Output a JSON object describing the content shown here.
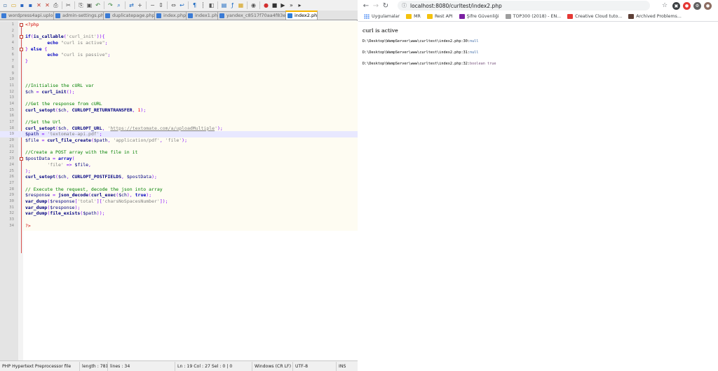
{
  "editor": {
    "toolbar_icons": [
      "new-file-icon",
      "open-file-icon",
      "save-icon",
      "save-all-icon",
      "close-icon",
      "close-all-icon",
      "print-icon",
      "cut-icon",
      "copy-icon",
      "paste-icon",
      "undo-icon",
      "redo-icon",
      "find-icon",
      "replace-icon",
      "zoom-in-icon",
      "zoom-out-icon",
      "sync-v-icon",
      "sync-h-icon",
      "word-wrap-icon",
      "all-chars-icon",
      "indent-guide-icon",
      "udl-icon",
      "doc-map-icon",
      "function-list-icon",
      "folder-workspace-icon",
      "monitor-icon",
      "record-icon",
      "stop-icon",
      "play-icon",
      "play-multi-icon",
      "save-macro-icon"
    ],
    "tabs": [
      {
        "label": "wordpress4api.uploader",
        "active": false
      },
      {
        "label": "admin-settings.php",
        "active": false
      },
      {
        "label": "duplicatepage.php",
        "active": false
      },
      {
        "label": "index.php",
        "active": false
      },
      {
        "label": "index1.php",
        "active": false
      },
      {
        "label": "yandex_c8517f70aa4f83e9b.html",
        "active": false
      },
      {
        "label": "index2.php",
        "active": true
      }
    ],
    "lines": [
      {
        "n": "1",
        "tokens": [
          [
            "php",
            "<?php"
          ]
        ]
      },
      {
        "n": "2",
        "tokens": []
      },
      {
        "n": "3",
        "tokens": [
          [
            "kw",
            "if"
          ],
          [
            "op",
            "("
          ],
          [
            "fn",
            "is_callable"
          ],
          [
            "op",
            "("
          ],
          [
            "str",
            "'curl_init'"
          ],
          [
            "op",
            "))"
          ],
          [
            "op",
            "{"
          ]
        ]
      },
      {
        "n": "4",
        "tokens": [
          [
            "",
            "        "
          ],
          [
            "kw",
            "echo"
          ],
          [
            "",
            " "
          ],
          [
            "str",
            "\"curl is active\""
          ],
          [
            "op",
            ";"
          ]
        ]
      },
      {
        "n": "5",
        "tokens": [
          [
            "op",
            "}"
          ],
          [
            "",
            " "
          ],
          [
            "kw",
            "else"
          ],
          [
            "",
            " "
          ],
          [
            "op",
            "{"
          ]
        ]
      },
      {
        "n": "6",
        "tokens": [
          [
            "",
            "        "
          ],
          [
            "kw",
            "echo"
          ],
          [
            "",
            " "
          ],
          [
            "str",
            "\"curl is passive\""
          ],
          [
            "op",
            ";"
          ]
        ]
      },
      {
        "n": "7",
        "tokens": [
          [
            "op",
            "}"
          ]
        ]
      },
      {
        "n": "8",
        "tokens": []
      },
      {
        "n": "9",
        "tokens": []
      },
      {
        "n": "10",
        "tokens": []
      },
      {
        "n": "11",
        "tokens": [
          [
            "cmt",
            "//Initialise the cURL var"
          ]
        ]
      },
      {
        "n": "12",
        "tokens": [
          [
            "var",
            "$ch"
          ],
          [
            "",
            " "
          ],
          [
            "op",
            "="
          ],
          [
            "",
            " "
          ],
          [
            "fn",
            "curl_init"
          ],
          [
            "op",
            "();"
          ]
        ]
      },
      {
        "n": "13",
        "tokens": []
      },
      {
        "n": "14",
        "tokens": [
          [
            "cmt",
            "//Get the response from cURL"
          ]
        ]
      },
      {
        "n": "15",
        "tokens": [
          [
            "fn",
            "curl_setopt"
          ],
          [
            "op",
            "("
          ],
          [
            "var",
            "$ch"
          ],
          [
            "op",
            ","
          ],
          [
            "",
            " "
          ],
          [
            "fn",
            "CURLOPT_RETURNTRANSFER"
          ],
          [
            "op",
            ","
          ],
          [
            "",
            " "
          ],
          [
            "num",
            "1"
          ],
          [
            "op",
            ");"
          ]
        ]
      },
      {
        "n": "16",
        "tokens": []
      },
      {
        "n": "17",
        "tokens": [
          [
            "cmt",
            "//Set the Url"
          ]
        ]
      },
      {
        "n": "18",
        "tokens": [
          [
            "fn",
            "curl_setopt"
          ],
          [
            "op",
            "("
          ],
          [
            "var",
            "$ch"
          ],
          [
            "op",
            ","
          ],
          [
            "",
            " "
          ],
          [
            "fn",
            "CURLOPT_URL"
          ],
          [
            "op",
            ","
          ],
          [
            "",
            " "
          ],
          [
            "str",
            "'"
          ],
          [
            "url",
            "https://textomate.com/a/uploadMultiple"
          ],
          [
            "str",
            "'"
          ],
          [
            "op",
            ");"
          ]
        ]
      },
      {
        "n": "19",
        "tokens": [
          [
            "var",
            "$path"
          ],
          [
            "",
            " "
          ],
          [
            "op",
            "="
          ],
          [
            "",
            " "
          ],
          [
            "str",
            "'textomate-api.pdf'"
          ],
          [
            "op",
            ";"
          ]
        ],
        "current": true
      },
      {
        "n": "20",
        "tokens": [
          [
            "var",
            "$file"
          ],
          [
            "",
            " "
          ],
          [
            "op",
            "="
          ],
          [
            "",
            " "
          ],
          [
            "fn",
            "curl_file_create"
          ],
          [
            "op",
            "("
          ],
          [
            "var",
            "$path"
          ],
          [
            "op",
            ","
          ],
          [
            "",
            " "
          ],
          [
            "str",
            "'application/pdf'"
          ],
          [
            "op",
            ","
          ],
          [
            "",
            " "
          ],
          [
            "str",
            "'file'"
          ],
          [
            "op",
            ");"
          ]
        ]
      },
      {
        "n": "21",
        "tokens": []
      },
      {
        "n": "22",
        "tokens": [
          [
            "cmt",
            "//Create a POST array with the file in it"
          ]
        ]
      },
      {
        "n": "23",
        "tokens": [
          [
            "var",
            "$postData"
          ],
          [
            "",
            " "
          ],
          [
            "op",
            "="
          ],
          [
            "",
            " "
          ],
          [
            "kw",
            "array"
          ],
          [
            "op",
            "("
          ]
        ]
      },
      {
        "n": "24",
        "tokens": [
          [
            "",
            "        "
          ],
          [
            "str",
            "'file'"
          ],
          [
            "",
            " "
          ],
          [
            "op",
            "=>"
          ],
          [
            "",
            " "
          ],
          [
            "var",
            "$file"
          ],
          [
            "op",
            ","
          ]
        ]
      },
      {
        "n": "25",
        "tokens": [
          [
            "op",
            ");"
          ]
        ]
      },
      {
        "n": "26",
        "tokens": [
          [
            "fn",
            "curl_setopt"
          ],
          [
            "op",
            "("
          ],
          [
            "var",
            "$ch"
          ],
          [
            "op",
            ","
          ],
          [
            "",
            " "
          ],
          [
            "fn",
            "CURLOPT_POSTFIELDS"
          ],
          [
            "op",
            ","
          ],
          [
            "",
            " "
          ],
          [
            "var",
            "$postData"
          ],
          [
            "op",
            ");"
          ]
        ]
      },
      {
        "n": "27",
        "tokens": []
      },
      {
        "n": "28",
        "tokens": [
          [
            "cmt",
            "// Execute the request, decode the json into array"
          ]
        ]
      },
      {
        "n": "29",
        "tokens": [
          [
            "var",
            "$response"
          ],
          [
            "",
            " "
          ],
          [
            "op",
            "="
          ],
          [
            "",
            " "
          ],
          [
            "fn",
            "json_decode"
          ],
          [
            "op",
            "("
          ],
          [
            "fn",
            "curl_exec"
          ],
          [
            "op",
            "("
          ],
          [
            "var",
            "$ch"
          ],
          [
            "op",
            ")"
          ],
          [
            "op",
            ","
          ],
          [
            "",
            " "
          ],
          [
            "kw",
            "true"
          ],
          [
            "op",
            ");"
          ]
        ]
      },
      {
        "n": "30",
        "tokens": [
          [
            "fn",
            "var_dump"
          ],
          [
            "op",
            "("
          ],
          [
            "var",
            "$response"
          ],
          [
            "op",
            "["
          ],
          [
            "str",
            "'total'"
          ],
          [
            "op",
            "]["
          ],
          [
            "str",
            "'charsNoSpacesNumber'"
          ],
          [
            "op",
            "]);"
          ]
        ]
      },
      {
        "n": "31",
        "tokens": [
          [
            "fn",
            "var_dump"
          ],
          [
            "op",
            "("
          ],
          [
            "var",
            "$response"
          ],
          [
            "op",
            ");"
          ]
        ]
      },
      {
        "n": "32",
        "tokens": [
          [
            "fn",
            "var_dump"
          ],
          [
            "op",
            "("
          ],
          [
            "fn",
            "file_exists"
          ],
          [
            "op",
            "("
          ],
          [
            "var",
            "$path"
          ],
          [
            "op",
            "));"
          ]
        ]
      },
      {
        "n": "33",
        "tokens": []
      },
      {
        "n": "34",
        "tokens": [
          [
            "php",
            "?>"
          ]
        ]
      }
    ],
    "status": {
      "language": "PHP Hypertext Preprocessor file",
      "length": "length : 781",
      "lines": "lines : 34",
      "position": "Ln : 19    Col : 27    Sel : 0 | 0",
      "eol": "Windows (CR LF)",
      "encoding": "UTF-8",
      "mode": "INS"
    }
  },
  "browser": {
    "url": "localhost:8080/curltest/index2.php",
    "bookmarks": [
      {
        "label": "Uygulamalar",
        "icon": "apps-icon"
      },
      {
        "label": "MR",
        "icon": "folder-icon"
      },
      {
        "label": "Rest API",
        "icon": "folder-icon"
      },
      {
        "label": "Şifre Güvenliği",
        "icon": "lock-icon"
      },
      {
        "label": "TOP300 (2018) - EN...",
        "icon": "page-icon"
      },
      {
        "label": "Creative Cloud tuto...",
        "icon": "adobe-icon"
      },
      {
        "label": "Archived Problems...",
        "icon": "site-icon"
      }
    ],
    "page": {
      "heading": "curl is active",
      "dumps": [
        {
          "path": "D:\\Desktop\\WampServer\\www\\curltest\\index2.php:30:",
          "value": "null",
          "kind": "null"
        },
        {
          "path": "D:\\Desktop\\WampServer\\www\\curltest\\index2.php:31:",
          "value": "null",
          "kind": "null"
        },
        {
          "path": "D:\\Desktop\\WampServer\\www\\curltest\\index2.php:32:",
          "type": "boolean",
          "value": "true",
          "kind": "bool"
        }
      ]
    }
  },
  "colors": {
    "gutter": "#e4e4e4",
    "code_bg": "#fefcf2",
    "current_line": "#e8e8ff",
    "keyword": "#0000c0",
    "comment": "#008000",
    "string": "#808080",
    "php_tag": "#d00000"
  }
}
